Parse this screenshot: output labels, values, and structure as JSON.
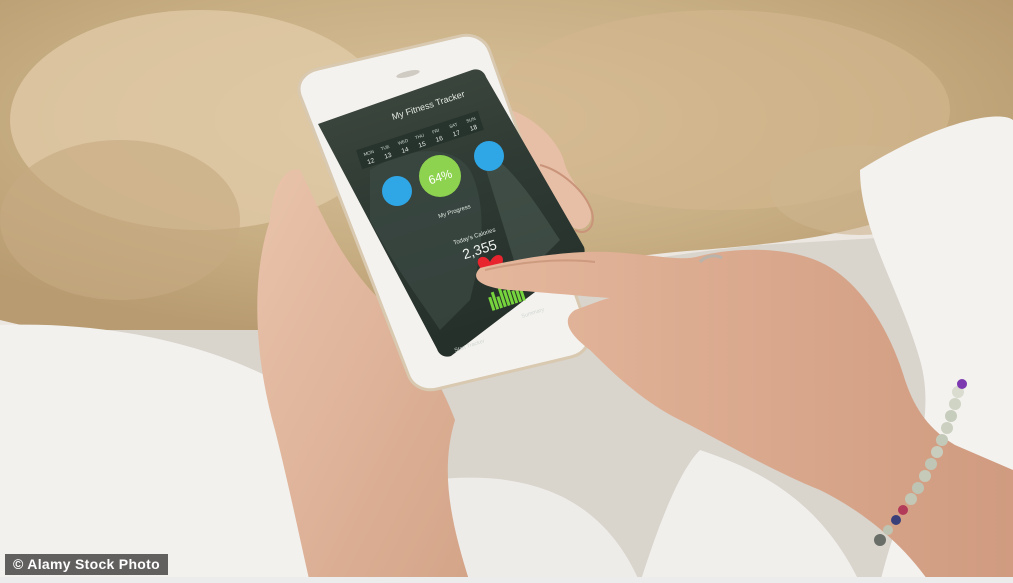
{
  "watermark": {
    "text": "© Alamy Stock Photo"
  },
  "app": {
    "title": "My Fitness Tracker",
    "weekdays": [
      "MON",
      "TUE",
      "WED",
      "THU",
      "FRI",
      "SAT",
      "SUN"
    ],
    "dates": [
      "12",
      "13",
      "14",
      "15",
      "16",
      "17",
      "18"
    ],
    "progress_percent": "64%",
    "progress_label": "My Progress",
    "calories_label": "Today's Calories",
    "calories_value": "2,355",
    "summary_label": "Summary",
    "footer_label": "Start Tracker"
  },
  "colors": {
    "progress_circle": "#8ed34f",
    "side_buttons": "#2fa6e6",
    "heart": "#e8242f",
    "bars": "#76d43c"
  }
}
